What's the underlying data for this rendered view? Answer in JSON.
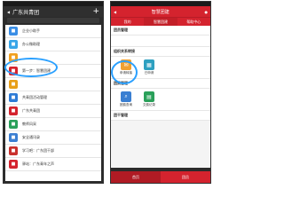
{
  "left": {
    "title": "广东共青团",
    "rows": [
      {
        "label": "企业小助手",
        "color": "#3a8ee6",
        "icon": "bot-icon"
      },
      {
        "label": "办公微助理",
        "color": "#39a6e8",
        "icon": "assistant-icon"
      },
      {
        "label": "",
        "color": "#f0a020",
        "icon": "chat-icon"
      },
      {
        "label": "第一步：智慧团建",
        "color": "#d4232e",
        "icon": "youth-league-icon"
      },
      {
        "label": "",
        "color": "#e8a01a",
        "icon": "message-icon"
      },
      {
        "label": "共青团活动管理",
        "color": "#2e7bd6",
        "icon": "activity-icon"
      },
      {
        "label": "广东共青团",
        "color": "#d4232e",
        "icon": "league-icon"
      },
      {
        "label": "教师风采",
        "color": "#2aa05a",
        "icon": "teacher-icon"
      },
      {
        "label": "安全通讯录",
        "color": "#3c7fd2",
        "icon": "contacts-icon"
      },
      {
        "label": "学习吧：广东团干部",
        "color": "#c9302c",
        "icon": "study-icon"
      },
      {
        "label": "驿站：广东青年之声",
        "color": "#d4232e",
        "icon": "voice-icon"
      }
    ]
  },
  "right": {
    "title": "智慧团建",
    "tabs": [
      "我的",
      "智慧团建",
      "帮助中心"
    ],
    "sections": {
      "s1": "团员管理",
      "s2": "组织关系转接",
      "s3": "团费管理",
      "s4": "团干管理"
    },
    "transfer": [
      {
        "label": "申请转接",
        "color": "#f0a030",
        "icon": "transfer-apply-icon"
      },
      {
        "label": "已申请",
        "color": "#2ea0c0",
        "icon": "applied-icon"
      }
    ],
    "fees": [
      {
        "label": "团费查询",
        "color": "#3a7fd2",
        "icon": "fee-query-icon"
      },
      {
        "label": "交费记录",
        "color": "#2aa05a",
        "icon": "fee-record-icon"
      }
    ],
    "bottom": [
      "首页",
      "团员"
    ]
  },
  "colors": {
    "brand_red": "#d4232e",
    "highlight_blue": "#2aa0ff"
  }
}
